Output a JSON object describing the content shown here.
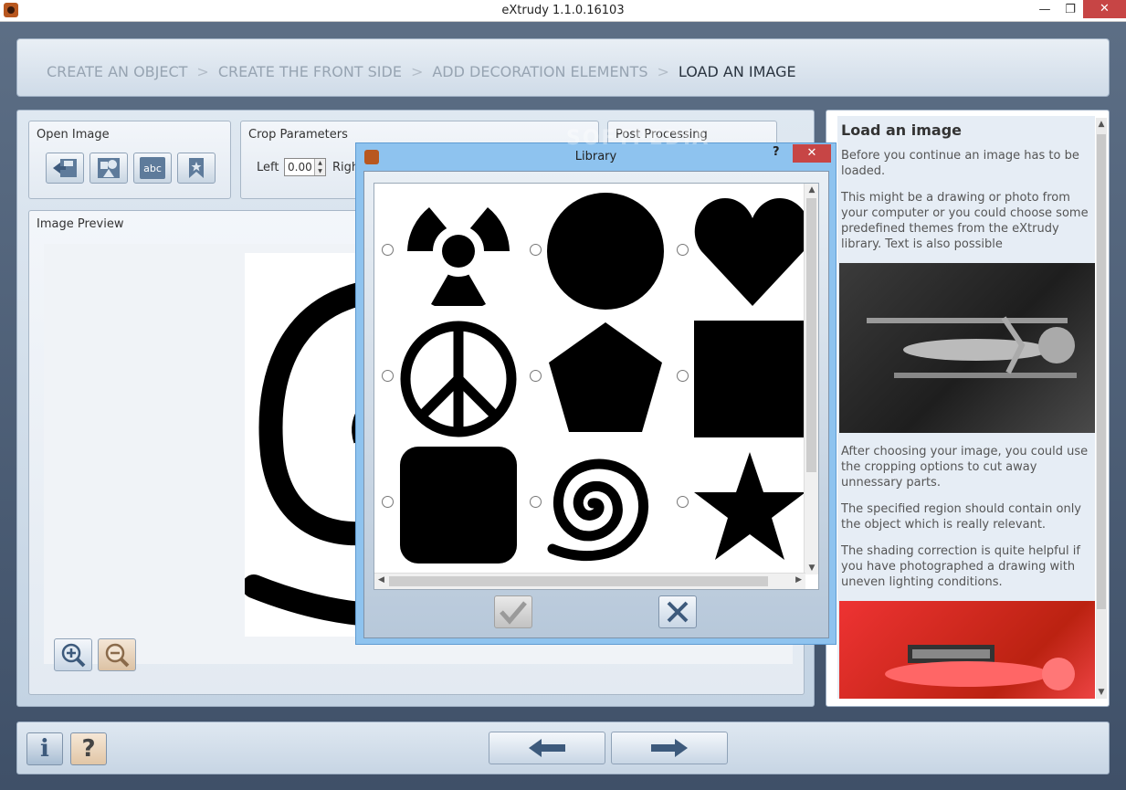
{
  "window": {
    "title": "eXtrudy 1.1.0.16103",
    "min_glyph": "—",
    "max_glyph": "❐",
    "close_glyph": "✕"
  },
  "breadcrumb": {
    "steps": [
      "CREATE AN OBJECT",
      "CREATE THE FRONT SIDE",
      "ADD DECORATION ELEMENTS",
      "LOAD AN IMAGE"
    ],
    "separator": ">",
    "active_index": 3
  },
  "open_image": {
    "title": "Open Image",
    "buttons": [
      "open-file-icon",
      "shapes-library-icon",
      "text-abc-icon",
      "bookmark-icon"
    ],
    "abc_label": "abc"
  },
  "crop": {
    "title": "Crop Parameters",
    "left_label": "Left",
    "left_value": "0.00",
    "right_label": "Righ"
  },
  "post_processing": {
    "title": "Post Processing"
  },
  "preview": {
    "title": "Image Preview"
  },
  "library": {
    "title": "Library",
    "help_glyph": "?",
    "close_glyph": "✕",
    "watermark": "SOFTPEDIA",
    "shapes": [
      "radiation",
      "circle",
      "heart",
      "peace",
      "pentagon",
      "square",
      "rounded-square",
      "spiral",
      "star"
    ]
  },
  "help": {
    "heading": "Load an image",
    "paragraphs": [
      "Before you continue an image has to be loaded.",
      "This might be a drawing or photo from your computer or you could choose some predefined themes from the eXtrudy library. Text is also possible",
      "After choosing your image, you could use the cropping options to cut away unnessary parts.",
      "The specified region should contain only the object which is really relevant.",
      "The shading correction is quite helpful if you have photographed a drawing with uneven lighting conditions."
    ]
  },
  "bottom": {
    "info_label": "i",
    "help_label": "?"
  },
  "colors": {
    "accent": "#5e7b9b",
    "close_red": "#c74545",
    "dialog_blue": "#8ec3ef"
  }
}
